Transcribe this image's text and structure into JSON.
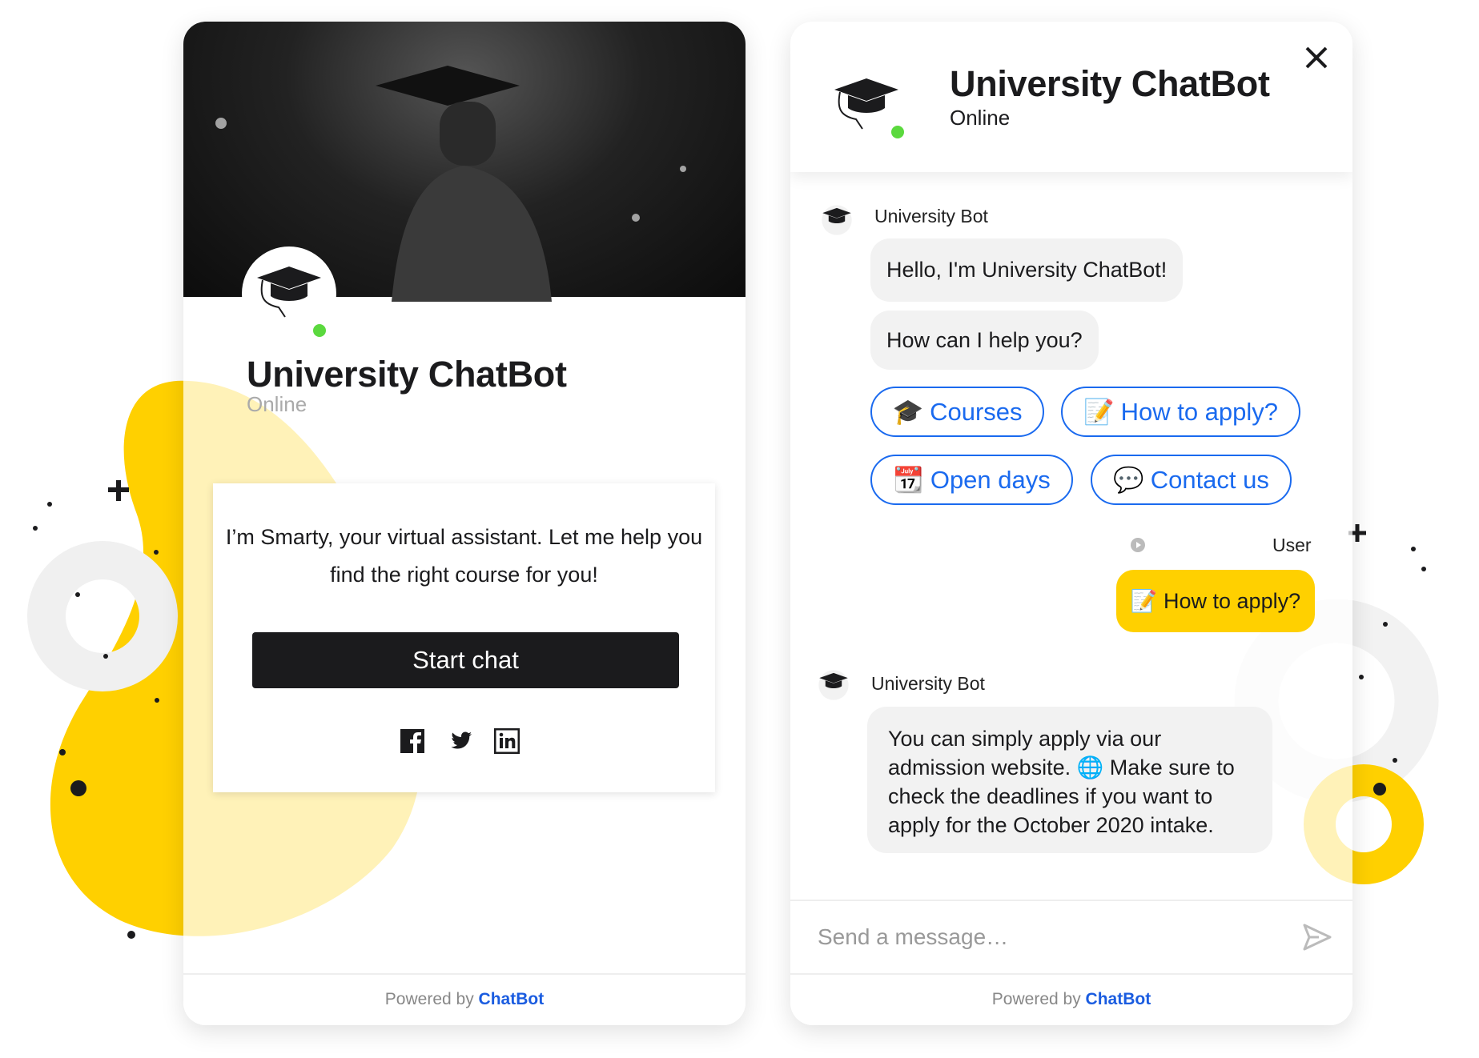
{
  "colors": {
    "accent": "#1a6aef",
    "yellow": "#ffd000",
    "online": "#5bd93e",
    "dark": "#1b1b1d"
  },
  "left_widget": {
    "title": "University ChatBot",
    "status": "Online",
    "intro_text": "I’m Smarty, your virtual assistant. Let me help you find the right course for you!",
    "start_button": "Start chat",
    "social": [
      "facebook-icon",
      "twitter-icon",
      "linkedin-icon"
    ],
    "powered_prefix": "Powered by",
    "powered_brand": "ChatBot"
  },
  "chat": {
    "title": "University ChatBot",
    "status": "Online",
    "bot_name": "University Bot",
    "messages": [
      "Hello, I'm University ChatBot!",
      "How can I help you?"
    ],
    "quick_replies": [
      {
        "emoji": "🎓",
        "label": "Courses"
      },
      {
        "emoji": "📝",
        "label": "How to apply?"
      },
      {
        "emoji": "📆",
        "label": "Open days"
      },
      {
        "emoji": "💬",
        "label": "Contact us"
      }
    ],
    "user_name": "User",
    "user_message": "📝 How to apply?",
    "bot_name_2": "University Bot",
    "bot_reply": "You can simply apply via our admission website. 🌐 Make sure to check the deadlines if you want to apply for the October 2020 intake.",
    "input_placeholder": "Send a message…",
    "powered_prefix": "Powered by",
    "powered_brand": "ChatBot"
  }
}
